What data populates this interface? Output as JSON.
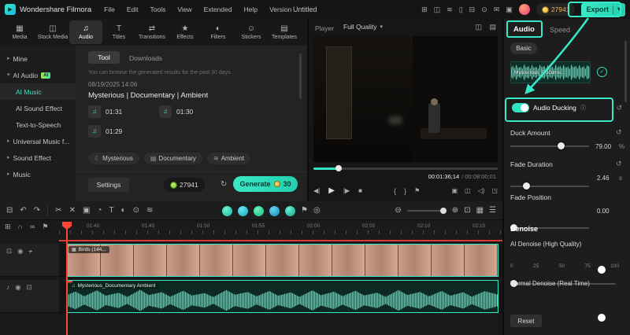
{
  "accent": "#2fe3c0",
  "titlebar": {
    "app_name": "Wondershare Filmora",
    "menus": [
      "File",
      "Edit",
      "Tools",
      "View",
      "Extended",
      "Help",
      "Version"
    ],
    "project_title": "Untitled",
    "coin_count": "27941",
    "export_label": "Export"
  },
  "media_tabs": [
    {
      "label": "Media"
    },
    {
      "label": "Stock Media"
    },
    {
      "label": "Audio"
    },
    {
      "label": "Titles"
    },
    {
      "label": "Transitions"
    },
    {
      "label": "Effects"
    },
    {
      "label": "Filters"
    },
    {
      "label": "Stickers"
    },
    {
      "label": "Templates"
    }
  ],
  "library": {
    "sidebar": [
      {
        "label": "Mine"
      },
      {
        "label": "AI Audio",
        "badge": "AI"
      },
      {
        "label": "AI Music"
      },
      {
        "label": "AI Sound Effect"
      },
      {
        "label": "Text-to-Speech"
      },
      {
        "label": "Universal Music f..."
      },
      {
        "label": "Sound Effect"
      },
      {
        "label": "Music"
      }
    ],
    "tab_tool": "Tool",
    "tab_downloads": "Downloads",
    "notice": "You can browse the generated results for the past 30 days",
    "result_date": "08/19/2025 14:06",
    "result_title": "Mysterious | Documentary | Ambient",
    "clip_durations": [
      "01:31",
      "01:30",
      "01:29"
    ],
    "tags": [
      "Mysterious",
      "Documentary",
      "Ambient"
    ],
    "settings_label": "Settings",
    "coin_count": "27941",
    "generate_label": "Generate",
    "generate_cost": "30"
  },
  "player": {
    "label": "Player",
    "quality": "Full Quality",
    "time_current": "00:01:36;14",
    "time_total": "/ 00:08:00;01"
  },
  "properties": {
    "tab_audio": "Audio",
    "tab_speed": "Speed",
    "basic_label": "Basic",
    "clip_name": "Mysterious_Docume...",
    "ducking_label": "Audio Ducking",
    "duck_amount": {
      "label": "Duck Amount",
      "value": "79.00",
      "unit": "%"
    },
    "fade_duration": {
      "label": "Fade Duration",
      "value": "2.46",
      "unit": "s"
    },
    "fade_position": {
      "label": "Fade Position",
      "value": "0.00"
    },
    "denoise_header": "Denoise",
    "ai_denoise_label": "AI Denoise (High Quality)",
    "denoise_ticks": [
      "0",
      "25",
      "50",
      "75",
      "100"
    ],
    "normal_denoise_label": "Normal Denoise (Real Time)",
    "reset_label": "Reset"
  },
  "timeline": {
    "ruler": [
      "01:40",
      "01:45",
      "01:50",
      "01:55",
      "02:00",
      "02:05",
      "02:10",
      "02:15"
    ],
    "video_clip_name": "Birds (144...",
    "audio_clip_name": "Mysterious_Documentary Ambient"
  },
  "icons": {
    "logo": "▶",
    "chevron_down": "▾",
    "chevron_right": "▸",
    "tb_layout": "⊞",
    "tb_switch": "◫",
    "tb_cloud": "≋",
    "tb_display": "▯",
    "tb_plugin": "⊟",
    "tb_gift": "⊙",
    "tb_mail": "✉",
    "tb_screen": "▣",
    "tab_media": "▦",
    "tab_stock": "◫",
    "tab_audio": "♫",
    "tab_titles": "T",
    "tab_transitions": "⇄",
    "tab_effects": "★",
    "tab_filters": "◐",
    "tab_stickers": "☺",
    "tab_templates": "▤",
    "note": "♫",
    "refresh": "↻",
    "reset": "↺",
    "info": "ⓘ",
    "check": "✓",
    "tag1": "☾",
    "tag2": "▤",
    "tag3": "≋",
    "pv_grid": "◫",
    "pv_chart": "▤",
    "skip_back": "◀|",
    "play": "▶",
    "skip_fwd": "|▶",
    "stop": "■",
    "brace_l": "{",
    "brace_r": "}",
    "marker": "⚑",
    "snapshot": "▣",
    "ratio": "◫",
    "speaker": "◁)",
    "expand": "◳",
    "select": "⊟",
    "undo": "↶",
    "redo": "↷",
    "split": "✂",
    "trash": "✕",
    "crop": "▣",
    "speed": "◔",
    "text": "T",
    "mask": "◐",
    "keyframe": "⊙",
    "render": "≋",
    "mic": "◎",
    "zoom_out": "⊖",
    "zoom_in": "⊕",
    "fit": "⊡",
    "grid": "▦",
    "list": "☰",
    "add_track": "⊞",
    "magnet": "∩",
    "link": "∞",
    "lock": "⊡",
    "eye": "◉",
    "mute": "♪"
  }
}
